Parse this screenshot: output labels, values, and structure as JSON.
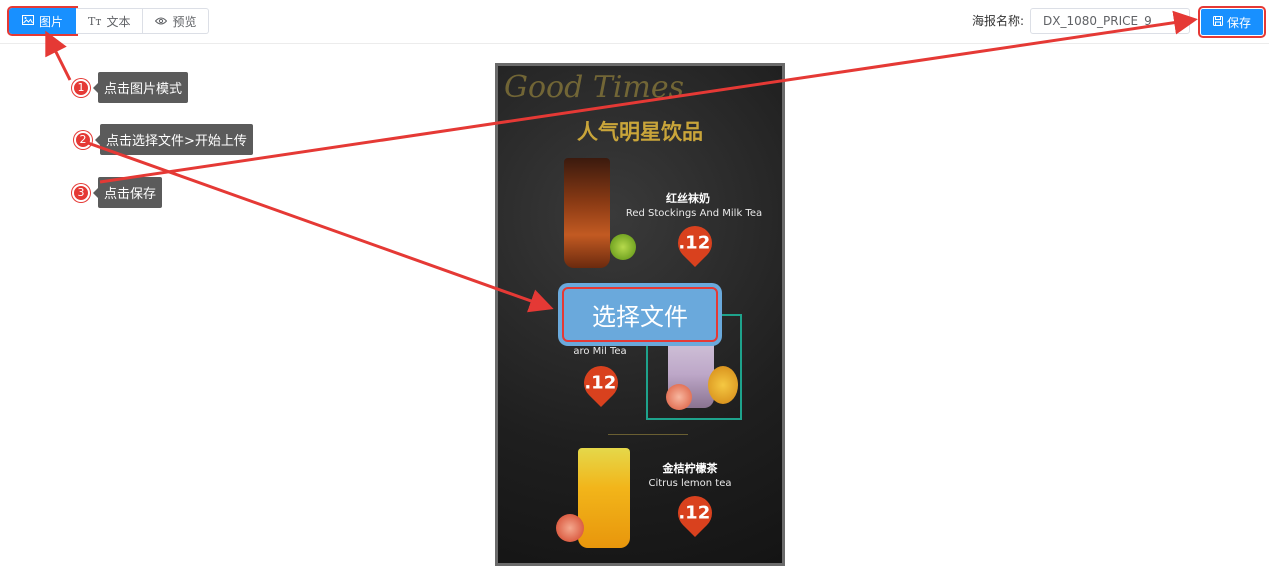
{
  "toolbar": {
    "modes": [
      {
        "label": "图片",
        "icon": "image-icon",
        "active": true
      },
      {
        "label": "文本",
        "icon": "text-icon",
        "active": false
      },
      {
        "label": "预览",
        "icon": "eye-icon",
        "active": false
      }
    ],
    "poster_name_label": "海报名称:",
    "poster_name_value": "DX_1080_PRICE_9",
    "save_label": "保存"
  },
  "tips": [
    {
      "num": "1",
      "text": "点击图片模式"
    },
    {
      "num": "2",
      "text": "点击选择文件>开始上传"
    },
    {
      "num": "3",
      "text": "点击保存"
    }
  ],
  "poster": {
    "deco_text": "Good Times",
    "title": "人气明星饮品",
    "drinks": [
      {
        "name": "红丝袜奶",
        "en": "Red Stockings And Milk Tea",
        "price": ".12"
      },
      {
        "name": "",
        "en": "aro Mil Tea",
        "price": ".12"
      },
      {
        "name": "金桔柠檬茶",
        "en": "Citrus lemon tea",
        "price": ".12"
      }
    ]
  },
  "upload": {
    "choose_file_label": "选择文件"
  },
  "colors": {
    "primary": "#1890ff",
    "highlight": "#e53935",
    "tip_bg": "#5b5b5b",
    "price": "#d9411e",
    "title_gold": "#c9a53a"
  }
}
